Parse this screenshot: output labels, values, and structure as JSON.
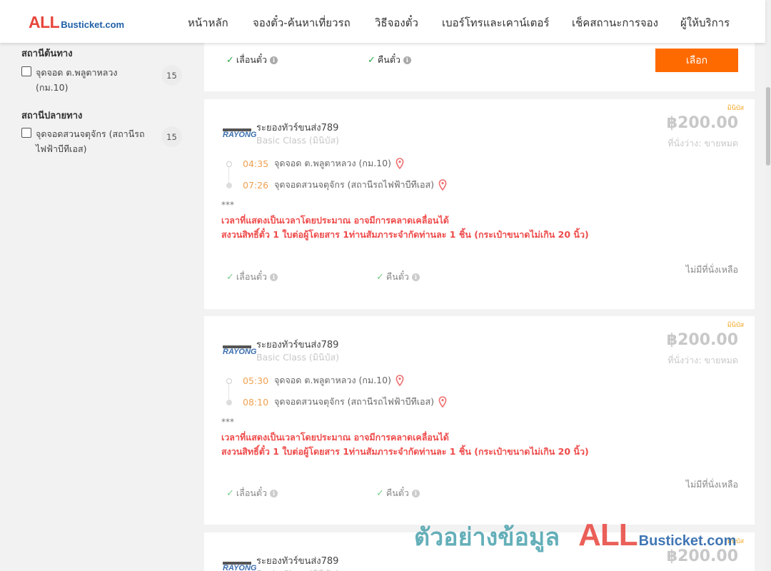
{
  "header": {
    "logo_main": "ALL",
    "logo_rest": "Busticket.com",
    "nav": [
      "หน้าหลัก",
      "จองตั๋ว-ค้นหาเที่ยวรถ",
      "วิธีจองตั๋ว",
      "เบอร์โทรและเคาน์เตอร์",
      "เช็คสถานะการจอง",
      "ผู้ให้บริการ"
    ]
  },
  "sidebar": {
    "origin_title": "สถานีต้นทาง",
    "origin_items": [
      {
        "label": "จุดจอด ต.พลูตาหลวง (กม.10)",
        "count": "15",
        "checked": false
      }
    ],
    "dest_title": "สถานีปลายทาง",
    "dest_items": [
      {
        "label": "จุดจอดสวนจตุจักร (สถานีรถไฟฟ้าบีทีเอส)",
        "count": "15",
        "checked": false
      }
    ]
  },
  "top_card": {
    "reschedule": "เลื่อนตั๋ว",
    "refund": "คืนตั๋ว",
    "select_label": "เลือก"
  },
  "trips": [
    {
      "tag": "มินิบัส",
      "logo_text": "RAYONG",
      "operator": "ระยองทัวร์ขนส่ง789",
      "class": "Basic Class (มินิบัส)",
      "price": "฿200.00",
      "seats": "ที่นั่งว่าง: ขายหมด",
      "depart_time": "04:35",
      "depart_stop": "จุดจอด ต.พลูตาหลวง (กม.10)",
      "arrive_time": "07:26",
      "arrive_stop": "จุดจอดสวนจตุจักร (สถานีรถไฟฟ้าบีทีเอส)",
      "stars": "***",
      "notice1": "เวลาที่แสดงเป็นเวลาโดยประมาณ อาจมีการคลาดเคลื่อนได้",
      "notice2": "สงวนสิทธิ์ตั๋ว 1 ใบต่อผู้โดยสาร 1ท่านสัมภาระจำกัดท่านละ 1 ชิ้น (กระเป๋าขนาดไม่เกิน 20 นิ้ว)",
      "reschedule": "เลื่อนตั๋ว",
      "refund": "คืนตั๋ว",
      "no_seat": "ไม่มีที่นั่งเหลือ"
    },
    {
      "tag": "มินิบัส",
      "logo_text": "RAYONG",
      "operator": "ระยองทัวร์ขนส่ง789",
      "class": "Basic Class (มินิบัส)",
      "price": "฿200.00",
      "seats": "ที่นั่งว่าง: ขายหมด",
      "depart_time": "05:30",
      "depart_stop": "จุดจอด ต.พลูตาหลวง (กม.10)",
      "arrive_time": "08:10",
      "arrive_stop": "จุดจอดสวนจตุจักร (สถานีรถไฟฟ้าบีทีเอส)",
      "stars": "***",
      "notice1": "เวลาที่แสดงเป็นเวลาโดยประมาณ อาจมีการคลาดเคลื่อนได้",
      "notice2": "สงวนสิทธิ์ตั๋ว 1 ใบต่อผู้โดยสาร 1ท่านสัมภาระจำกัดท่านละ 1 ชิ้น (กระเป๋าขนาดไม่เกิน 20 นิ้ว)",
      "reschedule": "เลื่อนตั๋ว",
      "refund": "คืนตั๋ว",
      "no_seat": "ไม่มีที่นั่งเหลือ"
    },
    {
      "tag": "มินิบัส",
      "logo_text": "RAYONG",
      "operator": "ระยองทัวร์ขนส่ง789",
      "class": "Basic Class (มินิบัส)",
      "price": "฿200.00"
    }
  ],
  "watermark": {
    "text": "ตัวอย่างข้อมูล",
    "all": "ALL",
    "rest": "Busticket.com"
  }
}
